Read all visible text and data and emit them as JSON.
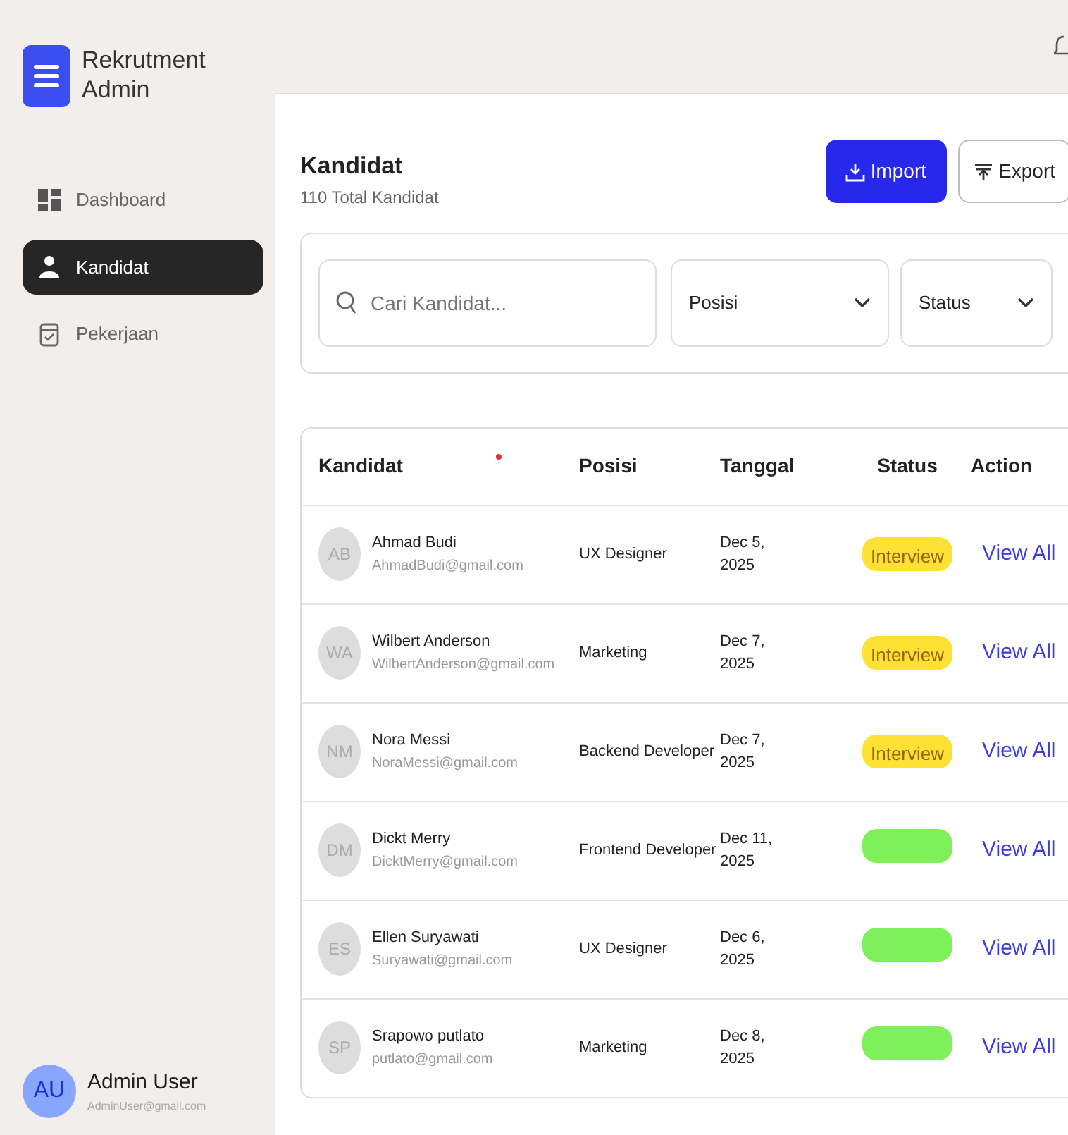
{
  "brand": {
    "title": "Rekrutment Admin"
  },
  "sidebar": {
    "items": [
      {
        "label": "Dashboard",
        "selected": false
      },
      {
        "label": "Kandidat",
        "selected": true
      },
      {
        "label": "Pekerjaan",
        "selected": false
      }
    ]
  },
  "user": {
    "initials": "AU",
    "name": "Admin User",
    "email": "AdminUser@gmail.com"
  },
  "header": {
    "title": "Kandidat",
    "subtitle": "110 Total Kandidat",
    "buttons": [
      {
        "label": "Import",
        "kind": "primary"
      },
      {
        "label": "Export",
        "kind": "outline"
      }
    ]
  },
  "filters": {
    "search": {
      "placeholder": "Cari Kandidat..."
    },
    "selects": [
      {
        "label": "Posisi"
      },
      {
        "label": "Status"
      }
    ]
  },
  "table": {
    "columns": [
      "Kandidat",
      "Posisi",
      "Tanggal",
      "Status",
      "Action"
    ],
    "rows": [
      {
        "initials": "AB",
        "name": "Ahmad Budi",
        "email": "AhmadBudi@gmail.com",
        "position": "UX Designer",
        "date": "Dec 5, 2025",
        "status": {
          "text": "Interview",
          "color": "#ffe135"
        },
        "action": "View All"
      },
      {
        "initials": "WA",
        "name": "Wilbert Anderson",
        "email": "WilbertAnderson@gmail.com",
        "position": "Marketing",
        "date": "Dec 7, 2025",
        "status": {
          "text": "Interview",
          "color": "#ffe135"
        },
        "action": "View All"
      },
      {
        "initials": "NM",
        "name": "Nora Messi",
        "email": "NoraMessi@gmail.com",
        "position": "Backend Developer",
        "date": "Dec 7, 2025",
        "status": {
          "text": "Interview",
          "color": "#ffe135"
        },
        "action": "View All"
      },
      {
        "initials": "DM",
        "name": "Dickt Merry",
        "email": "DicktMerry@gmail.com",
        "position": "Frontend Developer",
        "date": "Dec 11, 2025",
        "status": {
          "color": "#7ef05a"
        },
        "action": "View All"
      },
      {
        "initials": "ES",
        "name": "Ellen Suryawati",
        "email": "Suryawati@gmail.com",
        "position": "UX Designer",
        "date": "Dec 6, 2025",
        "status": {
          "color": "#7ef05a"
        },
        "action": "View All"
      },
      {
        "initials": "SP",
        "name": "Srapowo putlato",
        "email": "putlato@gmail.com",
        "position": "Marketing",
        "date": "Dec 8, 2025",
        "status": {
          "color": "#7ef05a"
        },
        "action": "View All"
      }
    ]
  }
}
